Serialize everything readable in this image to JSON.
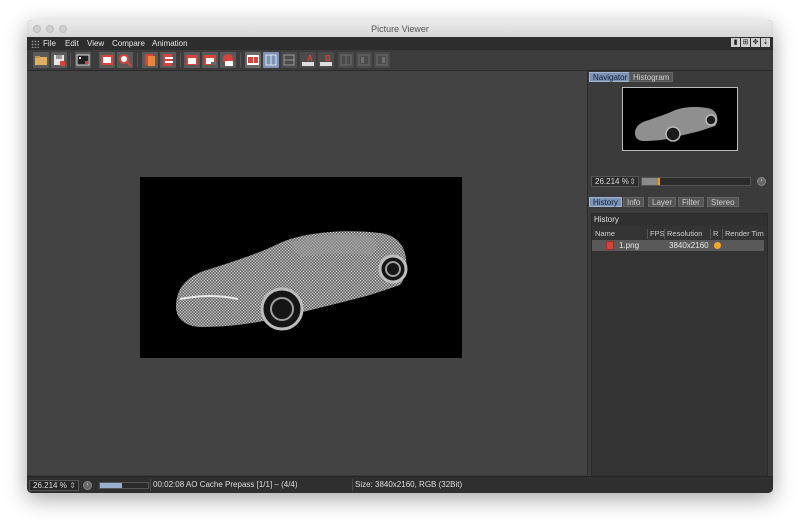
{
  "window": {
    "title": "Picture Viewer"
  },
  "menu": {
    "items": [
      "File",
      "Edit",
      "View",
      "Compare",
      "Animation"
    ]
  },
  "toolbar": {
    "buttons": [
      {
        "icon": "open-folder-icon"
      },
      {
        "icon": "save-icon"
      },
      {
        "icon": "film-strip-icon"
      },
      {
        "icon": "render-region-icon"
      },
      {
        "icon": "zoom-icon"
      },
      {
        "icon": "layer-stack-icon"
      },
      {
        "icon": "layer-copy-icon"
      },
      {
        "icon": "snapshot-icon"
      },
      {
        "icon": "snapshot-alt-icon"
      },
      {
        "icon": "ab-compare-icon"
      },
      {
        "icon": "a-b-compare-icon"
      },
      {
        "icon": "swap-icon"
      },
      {
        "icon": "set-a-icon"
      },
      {
        "icon": "set-b-icon"
      },
      {
        "icon": "compare-off-1-icon"
      },
      {
        "icon": "compare-off-2-icon"
      },
      {
        "icon": "compare-off-3-icon"
      }
    ],
    "a_label": "A",
    "b_label": "B"
  },
  "navigator": {
    "tabs": [
      "Navigator",
      "Histogram"
    ],
    "zoom": "26.214 %",
    "zoom_arrow": "⇕",
    "zoom_slider_fraction": 0.16
  },
  "history_tabs": [
    "History",
    "Info",
    "Layer",
    "Filter",
    "Stereo"
  ],
  "history": {
    "header": "History",
    "columns": [
      "Name",
      "FPS",
      "Resolution",
      "R",
      "Render Tim"
    ],
    "rows": [
      {
        "name": "1.png",
        "fps": "",
        "resolution": "3840x2160",
        "status_color": "#f5a623"
      }
    ]
  },
  "status": {
    "zoom": "26.214 %",
    "zoom_arrow": "⇕",
    "progress_fraction": 0.45,
    "message": "00:02:08 AO Cache Prepass [1/1] – (4/4)",
    "size_info": "Size: 3840x2160, RGB (32Bit)"
  },
  "colors": {
    "accent_tab": "#7d93b5",
    "window_bg": "#3a3a3a",
    "viewport_bg": "#434343",
    "status_orange": "#f5a623",
    "icon_red": "#d6433b"
  }
}
